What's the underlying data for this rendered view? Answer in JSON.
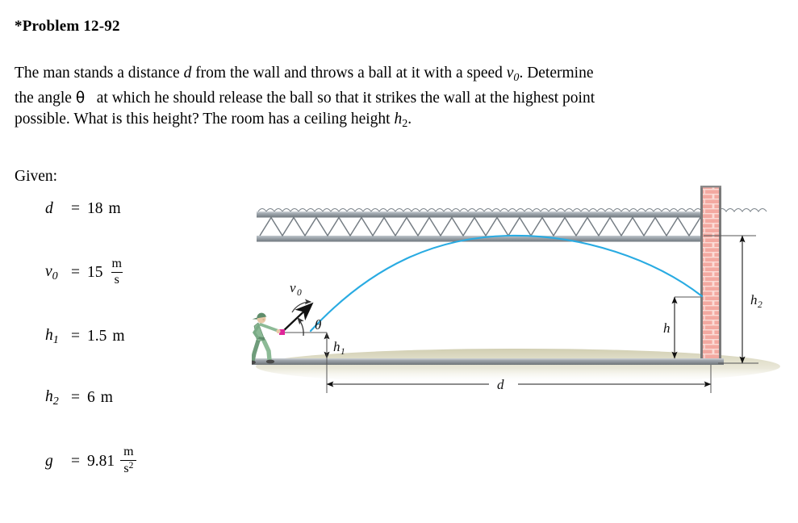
{
  "problem": {
    "title": "*Problem 12-92",
    "statement_lines": [
      "The man stands a distance d from the wall and throws a ball at it with a speed v0. Determine",
      "the angle θ at which he should release the ball so that it strikes the wall at the highest point",
      "possible. What is this height? The room has a ceiling height h2."
    ],
    "given_label": "Given:",
    "given": [
      {
        "symbol": "d",
        "sub": "",
        "equals": "=",
        "value": "18",
        "unit": "m",
        "unit_num": "",
        "unit_den": ""
      },
      {
        "symbol": "v",
        "sub": "0",
        "equals": "=",
        "value": "15",
        "unit": "",
        "unit_num": "m",
        "unit_den": "s"
      },
      {
        "symbol": "h",
        "sub": "1",
        "equals": "=",
        "value": "1.5",
        "unit": "m",
        "unit_num": "",
        "unit_den": ""
      },
      {
        "symbol": "h",
        "sub": "2",
        "equals": "=",
        "value": "6",
        "unit": "m",
        "unit_num": "",
        "unit_den": ""
      },
      {
        "symbol": "g",
        "sub": "",
        "equals": "=",
        "value": "9.81",
        "unit": "",
        "unit_num": "m",
        "unit_den": "s2"
      }
    ]
  },
  "figure": {
    "labels": {
      "v0_symbol": "v",
      "v0_sub": "0",
      "theta": "θ",
      "h1_symbol": "h",
      "h1_sub": "1",
      "h2_symbol": "h",
      "h2_sub": "2",
      "h_symbol": "h",
      "d_symbol": "d"
    },
    "colors": {
      "trajectory": "#29abe2",
      "wall_brick": "#f3a9a1",
      "wall_mortar": "#f8d5d0",
      "wall_edge": "#6b6b6b",
      "truss_metal": "#8e959b",
      "truss_chord": "#6f777d",
      "floor": "#8a9096",
      "floor_shadow": "#d8d6be",
      "ball": "#e0269a",
      "man_suit": "#8cba96",
      "man_suit_dark": "#5f8d6b",
      "arrow": "#111111"
    },
    "elements": {
      "ceiling_truss": "truss-ceiling",
      "wall": "brick-wall",
      "floor": "floor-slab",
      "ball": "ball-marker",
      "thrower": "man-throwing",
      "trajectory": "ball-trajectory",
      "velocity_arrow": "velocity-vector",
      "angle_arc": "theta-angle-arc"
    }
  }
}
